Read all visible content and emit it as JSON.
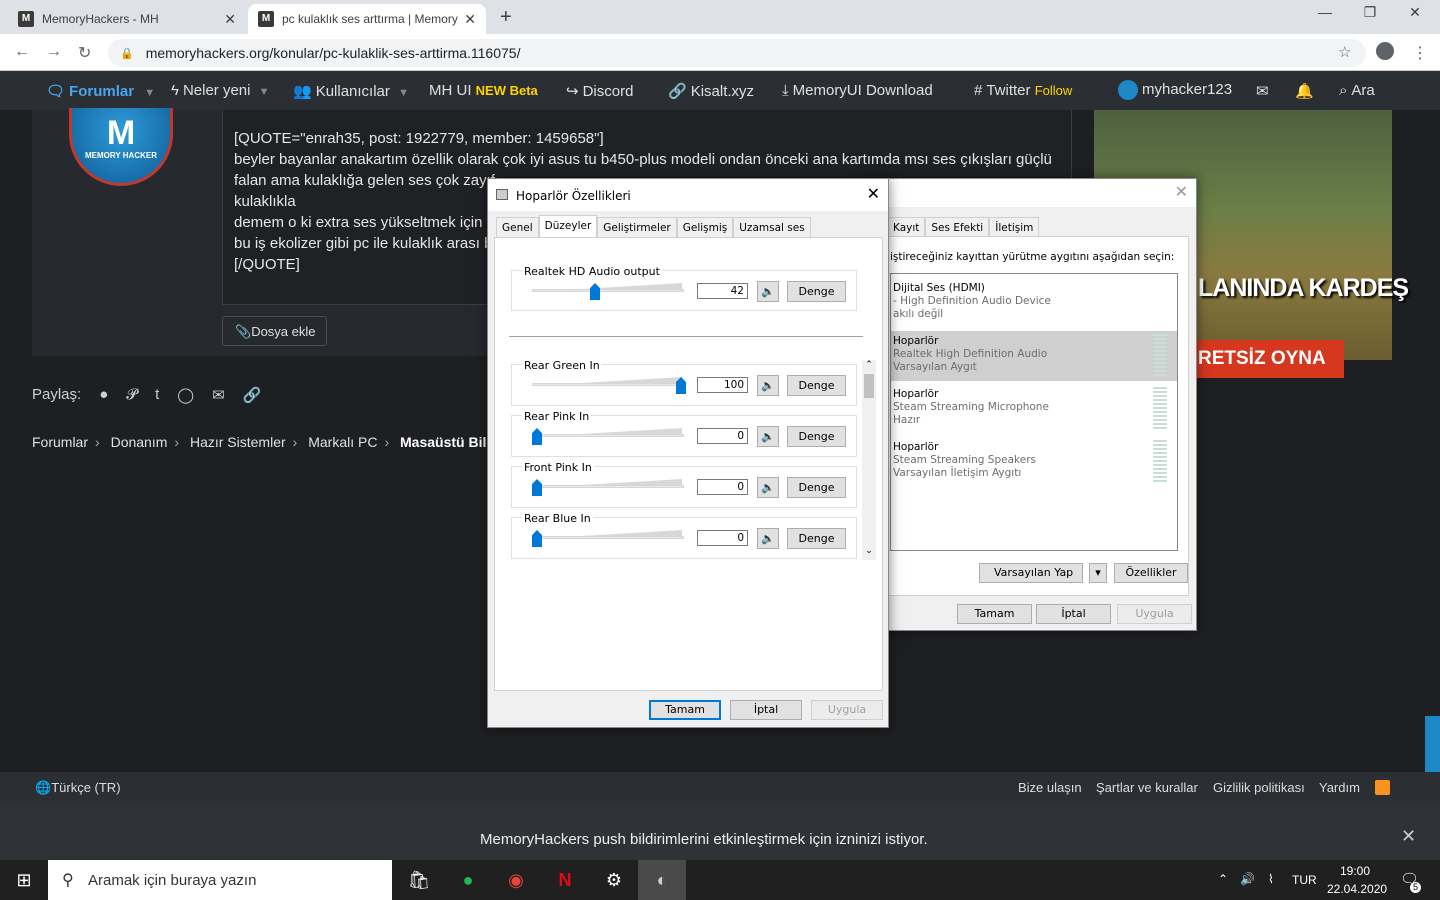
{
  "browser": {
    "tabs": [
      {
        "title": "MemoryHackers - MH",
        "favicon": "M"
      },
      {
        "title": "pc kulaklık ses arttırma | Memory",
        "favicon": "M"
      }
    ],
    "url": "memoryhackers.org/konular/pc-kulaklik-ses-arttirma.116075/"
  },
  "nav": {
    "forumlar": "Forumlar",
    "neler_yeni": "Neler yeni",
    "kullanicilar": "Kullanıcılar",
    "mhui": "MH UI",
    "mhui_badge": "NEW Beta",
    "discord": "Discord",
    "kisalt": "Kisalt.xyz",
    "memoryui": "MemoryUI Download",
    "twitter": "Twitter",
    "twitter_follow": "Follow",
    "user": "myhacker123",
    "search": "Ara"
  },
  "avatar": {
    "letters": "M",
    "caption": "MEMORY HACKER"
  },
  "editor": {
    "lines": [
      "[QUOTE=\"enrah35, post: 1922779, member: 1459658\"]",
      "beyler bayanlar anakartım özellik olarak çok iyi asus tu b450-plus modeli ondan önceki ana kartımda msı ses çıkışları güçlü",
      "falan ama kulaklığa gelen ses çok zayıf",
      "kulaklıkla",
      "demem o ki extra ses yükseltmek için",
      "bu iş ekolizer gibi pc ile kulaklık arası b",
      "[/QUOTE]"
    ]
  },
  "attach_button": "Dosya ekle",
  "share_label": "Paylaş:",
  "breadcrumbs": [
    "Forumlar",
    "Donanım",
    "Hazır Sistemler",
    "Markalı PC",
    "Masaüstü Bilgisay"
  ],
  "ad": {
    "headline": "LANINDA KARDEŞ",
    "cta": "RETSİZ OYNA"
  },
  "footer": {
    "language": "Türkçe (TR)",
    "links": [
      "Bize ulaşın",
      "Şartlar ve kurallar",
      "Gizlilik politikası",
      "Yardım"
    ]
  },
  "push": {
    "brand": "MemoryHackers",
    "message": " push bildirimlerini etkinleştirmek için izninizi istiyor."
  },
  "taskbar": {
    "search_placeholder": "Aramak için buraya yazın",
    "lang": "TUR",
    "time": "19:00",
    "date": "22.04.2020",
    "notif_count": "5"
  },
  "sound_dialog": {
    "tabs": [
      "Kayıt",
      "Ses Efekti",
      "İletişim"
    ],
    "instruction": "iştireceğiniz kayıttan yürütme aygıtını aşağıdan seçin:",
    "devices": [
      {
        "name": "Dijital Ses (HDMI)",
        "desc": "- High Definition Audio Device",
        "status": "akılı değil",
        "selected": false
      },
      {
        "name": "Hoparlör",
        "desc": "Realtek High Definition Audio",
        "status": "Varsayılan Aygıt",
        "selected": true
      },
      {
        "name": "Hoparlör",
        "desc": "Steam Streaming Microphone",
        "status": "Hazır",
        "selected": false
      },
      {
        "name": "Hoparlör",
        "desc": "Steam Streaming Speakers",
        "status": "Varsayılan İletişim Aygıtı",
        "selected": false
      }
    ],
    "set_default": "Varsayılan Yap",
    "properties": "Özellikler",
    "ok": "Tamam",
    "cancel": "İptal",
    "apply": "Uygula"
  },
  "speaker_dialog": {
    "title": "Hoparlör Özellikleri",
    "tabs": [
      "Genel",
      "Düzeyler",
      "Geliştirmeler",
      "Gelişmiş",
      "Uzamsal ses"
    ],
    "selected_tab": "Düzeyler",
    "levels": [
      {
        "label": "Realtek HD Audio output",
        "value": "42",
        "balance": "Denge"
      },
      {
        "label": "Rear Green In",
        "value": "100",
        "balance": "Denge"
      },
      {
        "label": "Rear Pink In",
        "value": "0",
        "balance": "Denge"
      },
      {
        "label": "Front Pink In",
        "value": "0",
        "balance": "Denge"
      },
      {
        "label": "Rear Blue In",
        "value": "0",
        "balance": "Denge"
      }
    ],
    "ok": "Tamam",
    "cancel": "İptal",
    "apply": "Uygula"
  },
  "colors": {
    "accent": "#0078d7",
    "site_nav": "#2b2e33",
    "brand_blue": "#47a7eb",
    "highlight": "#ffd400"
  }
}
